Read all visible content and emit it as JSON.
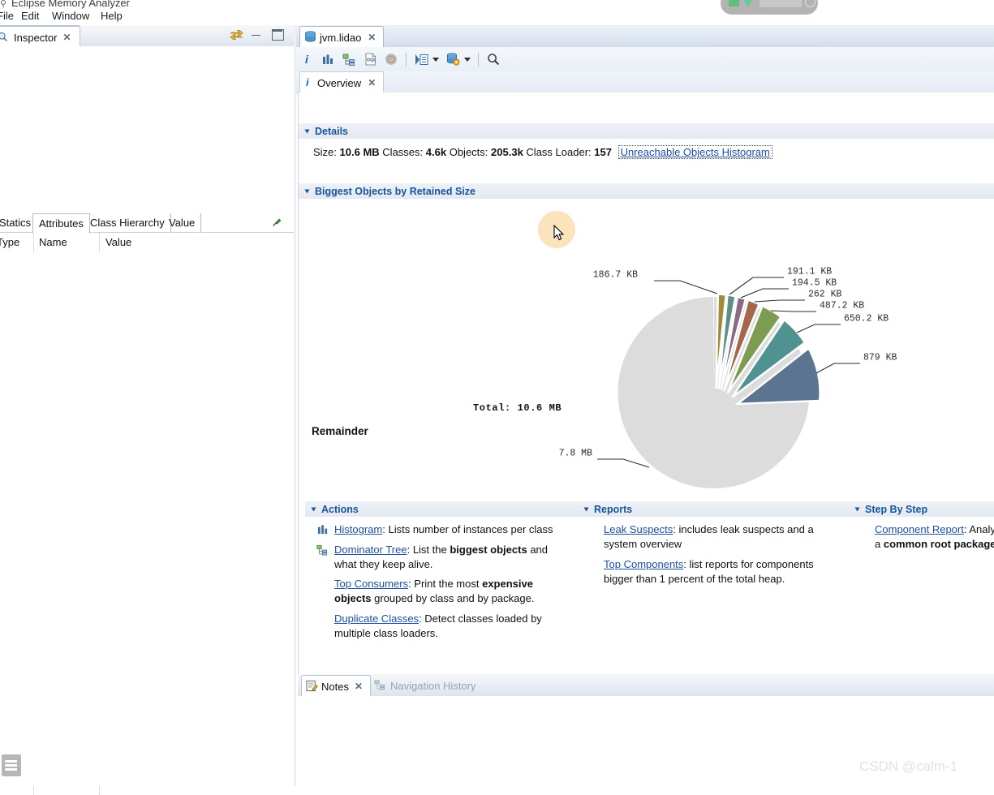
{
  "app": {
    "title": "Eclipse Memory Analyzer",
    "title_icon": "magnifier-icon",
    "menus": [
      "File",
      "Edit",
      "Window",
      "Help"
    ]
  },
  "inspector": {
    "tab_label": "Inspector",
    "tab_icon": "inspector-icon",
    "close_icon": "✕",
    "toolbar_icons": [
      "link-arrows-icon",
      "minimize-icon",
      "maximize-icon"
    ],
    "subtabs": [
      {
        "label": "Statics",
        "selected": false
      },
      {
        "label": "Attributes",
        "selected": true
      },
      {
        "label": "Class Hierarchy",
        "selected": false
      },
      {
        "label": "Value",
        "selected": false
      }
    ],
    "pin_icon": "pin-icon",
    "columns": [
      "Type",
      "Name",
      "Value"
    ],
    "rows": []
  },
  "editor": {
    "tab_label": "jvm.lidao",
    "tab_icon": "heap-dump-icon",
    "close_icon": "✕",
    "toolbar": [
      {
        "name": "overview-info-icon",
        "glyph": "i"
      },
      {
        "name": "histogram-icon",
        "glyph": "bars"
      },
      {
        "name": "dominator-tree-icon",
        "glyph": "tree"
      },
      {
        "name": "oql-icon",
        "glyph": "OQL"
      },
      {
        "name": "settings-gear-icon",
        "glyph": "gear"
      },
      {
        "name": "run-query-icon",
        "glyph": "run"
      },
      {
        "name": "run-query-dropdown-icon",
        "glyph": "caret"
      },
      {
        "name": "heap-dump-actions-icon",
        "glyph": "db-gear"
      },
      {
        "name": "heap-dump-actions-dropdown-icon",
        "glyph": "caret"
      },
      {
        "name": "search-icon",
        "glyph": "magnifier"
      }
    ]
  },
  "overview": {
    "tab_label": "Overview",
    "tab_icon": "info-icon",
    "close_icon": "✕",
    "details": {
      "header": "Details",
      "size_label": "Size:",
      "size_value": "10.6 MB",
      "classes_label": "Classes:",
      "classes_value": "4.6k",
      "objects_label": "Objects:",
      "objects_value": "205.3k",
      "classloader_label": "Class Loader:",
      "classloader_value": "157",
      "link": "Unreachable Objects Histogram"
    },
    "biggest": {
      "header": "Biggest Objects by Retained Size",
      "total_label": "Total: 10.6 MB",
      "remainder_label": "Remainder"
    }
  },
  "chart_data": {
    "type": "pie",
    "title": "Biggest Objects by Retained Size",
    "total": "10.6 MB",
    "legend_position": "none",
    "labels": [
      "7.8 MB",
      "186.7 KB",
      "191.1 KB",
      "194.5 KB",
      "262 KB",
      "487.2 KB",
      "650.2 KB",
      "879 KB"
    ],
    "slices": [
      {
        "label": "7.8 MB",
        "bytes": 8178892,
        "color": "#dcdcdc",
        "exploded": false
      },
      {
        "label": "186.7 KB",
        "bytes": 191181,
        "color": "#a08a3c",
        "exploded": true
      },
      {
        "label": "191.1 KB",
        "bytes": 195686,
        "color": "#5e8f84",
        "exploded": true
      },
      {
        "label": "194.5 KB",
        "bytes": 199168,
        "color": "#8a6b84",
        "exploded": true
      },
      {
        "label": "262 KB",
        "bytes": 268288,
        "color": "#a4664d",
        "exploded": true
      },
      {
        "label": "487.2 KB",
        "bytes": 498892,
        "color": "#7d9c52",
        "exploded": true
      },
      {
        "label": "650.2 KB",
        "bytes": 665804,
        "color": "#4f9290",
        "exploded": true
      },
      {
        "label": "879 KB",
        "bytes": 900096,
        "color": "#5b7591",
        "exploded": true
      }
    ],
    "units": "bytes",
    "ylabel": "",
    "xlabel": ""
  },
  "actions": {
    "header": "Actions",
    "items": [
      {
        "icon": "histogram-icon",
        "link": "Histogram",
        "text": ": Lists number of instances per class"
      },
      {
        "icon": "dominator-tree-icon",
        "link": "Dominator Tree",
        "text": ": List the ",
        "bold": "biggest objects",
        "text2": " and",
        "line2": "what they keep alive."
      },
      {
        "icon": "",
        "link": "Top Consumers",
        "text": ": Print the most ",
        "bold": "expensive",
        "line2": "objects",
        "line2_rest": " grouped by class and by package."
      },
      {
        "icon": "",
        "link": "Duplicate Classes",
        "text": ": Detect classes loaded by",
        "line2": "multiple class loaders."
      }
    ]
  },
  "reports": {
    "header": "Reports",
    "items": [
      {
        "link": "Leak Suspects",
        "text": ": includes leak suspects and a",
        "line2": "system overview"
      },
      {
        "link": "Top Components",
        "text": ": list reports for components",
        "line2": "bigger than 1 percent of the total heap."
      }
    ]
  },
  "stepbystep": {
    "header": "Step By Step",
    "items": [
      {
        "link": "Component Report",
        "text": ": Analy",
        "line2_prefix": "a ",
        "line2_bold": "common root package"
      }
    ]
  },
  "notes": {
    "tab_label": "Notes",
    "tab_icon": "notes-icon",
    "close_icon": "✕",
    "other_tab_label": "Navigation History",
    "other_tab_icon": "navigation-history-icon",
    "content": ""
  },
  "watermark": "CSDN @calm-1",
  "colors": {
    "section_header_text": "#16559b",
    "link": "#1c4fa5",
    "remainder_slice": "#dcdcdc",
    "cursor_highlight": "#fadfb0"
  }
}
